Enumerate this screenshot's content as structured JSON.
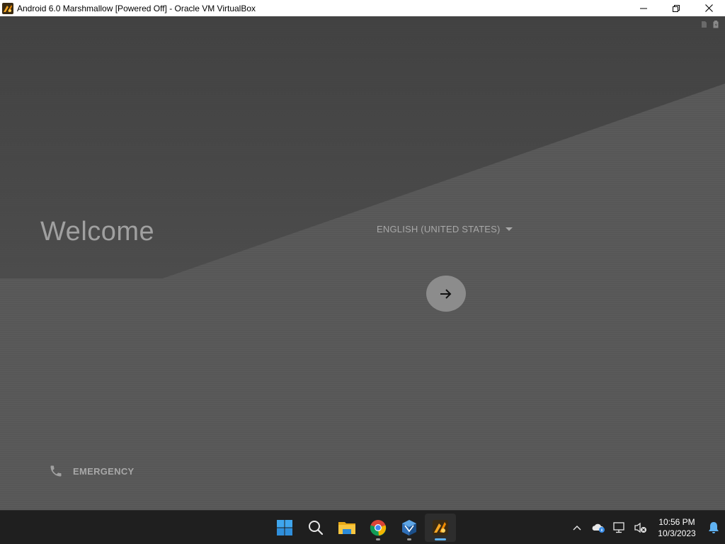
{
  "window": {
    "title": "Android 6.0 Marshmallow [Powered Off] - Oracle VM VirtualBox",
    "app_icon": "virtualbox-vm-icon",
    "controls": [
      "minimize-icon",
      "restore-icon",
      "close-icon"
    ]
  },
  "android": {
    "welcome": "Welcome",
    "language": "ENGLISH (UNITED STATES)",
    "next_icon": "arrow-right-icon",
    "emergency": "EMERGENCY",
    "emergency_icon": "phone-icon"
  },
  "taskbar": {
    "apps": [
      {
        "name": "start-button",
        "icon": "windows-start-icon"
      },
      {
        "name": "search-button",
        "icon": "search-icon"
      },
      {
        "name": "file-explorer-button",
        "icon": "folder-icon"
      },
      {
        "name": "chrome-button",
        "icon": "chrome-icon"
      },
      {
        "name": "virtualbox-button",
        "icon": "virtualbox-icon"
      },
      {
        "name": "vm-window-button",
        "icon": "virtualbox-vm-icon"
      }
    ],
    "tray": {
      "icons": [
        "chevron-up-icon",
        "onedrive-icon",
        "network-icon",
        "volume-muted-icon"
      ],
      "time": "10:56 PM",
      "date": "10/3/2023",
      "notification_icon": "bell-icon"
    }
  },
  "colors": {
    "accent": "#5fb2f2",
    "screen_background": "#575757",
    "text": "#a8a8a8"
  }
}
